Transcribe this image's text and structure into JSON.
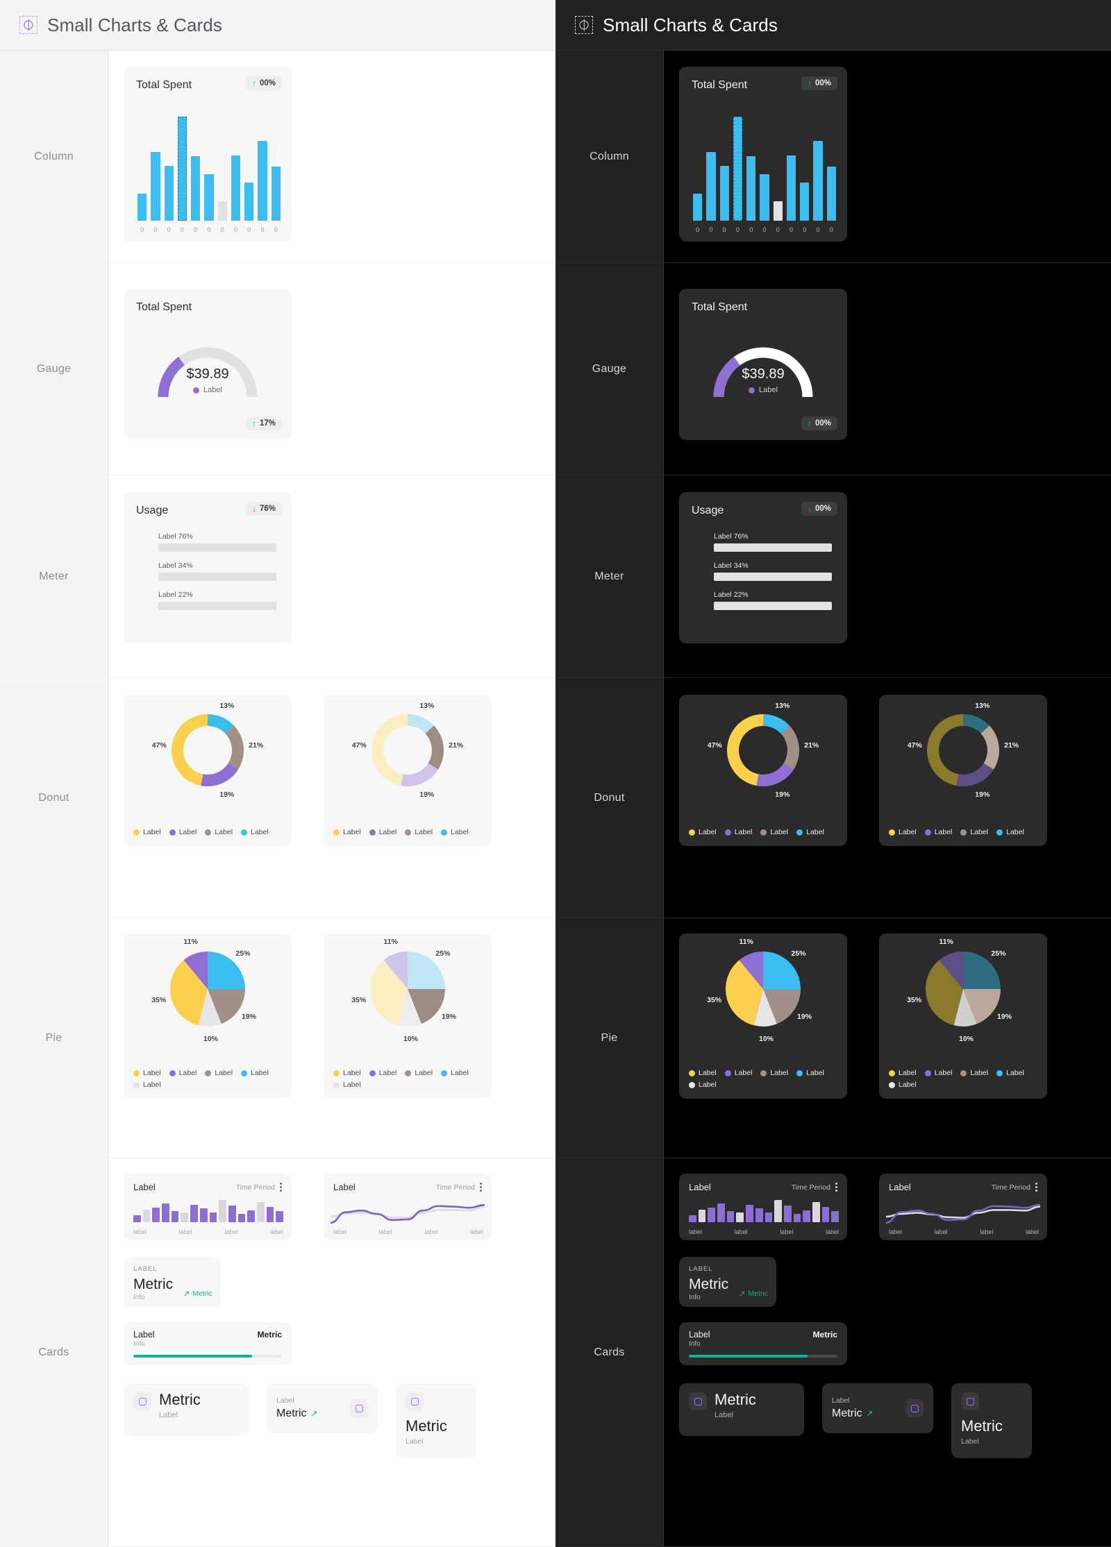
{
  "header": {
    "title": "Small Charts & Cards",
    "icon": "target-crosshair-icon"
  },
  "rows": [
    {
      "label": "Column"
    },
    {
      "label": "Gauge"
    },
    {
      "label": "Meter"
    },
    {
      "label": "Donut"
    },
    {
      "label": "Pie"
    },
    {
      "label": "Cards"
    }
  ],
  "column_card": {
    "title": "Total Spent",
    "badge": {
      "arrow": "↑",
      "text": "00%",
      "direction": "up"
    }
  },
  "gauge_card": {
    "title": "Total Spent",
    "value": "$39.89",
    "legend_label": "Label",
    "badge_light": {
      "arrow": "↑",
      "text": "17%",
      "direction": "up"
    },
    "badge_dark": {
      "arrow": "↑",
      "text": "00%",
      "direction": "up"
    }
  },
  "meter_card": {
    "title": "Usage",
    "badge_light": {
      "arrow": "↓",
      "text": "76%",
      "direction": "down"
    },
    "badge_dark": {
      "arrow": "↓",
      "text": "00%",
      "direction": "down"
    },
    "bars": [
      {
        "label": "Label 76%",
        "value": 76,
        "color": "#ef4a4a"
      },
      {
        "label": "Label 34%",
        "value": 34,
        "color": "#f7cf3f"
      },
      {
        "label": "Label 22%",
        "value": 22,
        "color": "#68c17a"
      }
    ]
  },
  "legend_label": "Label",
  "cards": {
    "bar_spark": {
      "title": "Label",
      "time_period": "Time Period",
      "xlabels": [
        "label",
        "label",
        "label",
        "label"
      ]
    },
    "line_spark": {
      "title": "Label",
      "time_period": "Time Period",
      "xlabels": [
        "label",
        "label",
        "label",
        "label"
      ]
    },
    "metric_a": {
      "label": "LABEL",
      "metric": "Metric",
      "info": "Info",
      "change_arrow": "↗",
      "change": "Metric"
    },
    "metric_b": {
      "label": "Label",
      "info": "Info",
      "metric": "Metric",
      "progress": 80
    },
    "metric_c": {
      "metric": "Metric",
      "label": "Label",
      "icon": "square-icon"
    },
    "metric_d": {
      "label": "Label",
      "metric": "Metric",
      "arrow": "↗",
      "icon": "square-icon"
    },
    "metric_e": {
      "metric": "Metric",
      "label": "Label",
      "icon": "square-icon"
    }
  },
  "chart_data": [
    {
      "type": "bar",
      "title": "Total Spent",
      "name": "column-chart",
      "categories": [
        "0",
        "0",
        "0",
        "0",
        "0",
        "0",
        "0",
        "0",
        "0",
        "0",
        "0"
      ],
      "values": [
        26,
        66,
        53,
        100,
        62,
        45,
        19,
        63,
        37,
        77,
        52
      ],
      "inactive_index": 6,
      "selected_index": 3,
      "color": "#3cbdf0",
      "inactive_color": "#e2e2e4",
      "ylim": [
        0,
        100
      ],
      "grid": false
    },
    {
      "type": "gauge",
      "title": "Total Spent",
      "name": "gauge-chart",
      "value": 39.89,
      "value_label": "$39.89",
      "percent": 30,
      "color": "#8e6fd4",
      "track_color": "#e2e2e4",
      "legend": [
        "Label"
      ]
    },
    {
      "type": "bar",
      "name": "meter-chart",
      "title": "Usage",
      "orientation": "horizontal",
      "categories": [
        "Label 76%",
        "Label 34%",
        "Label 22%"
      ],
      "values": [
        76,
        34,
        22
      ],
      "colors": [
        "#ef4a4a",
        "#f7cf3f",
        "#68c17a"
      ],
      "ylim": [
        0,
        100
      ]
    },
    {
      "type": "pie",
      "name": "donut-chart-primary",
      "variant": "donut",
      "labels": [
        "Label",
        "Label",
        "Label",
        "Label"
      ],
      "values": [
        47,
        19,
        21,
        13
      ],
      "display_order": [
        13,
        21,
        19,
        47
      ],
      "colors": [
        "#fbd04d",
        "#8e6fd4",
        "#a29086",
        "#3cbdf0"
      ],
      "legend_position": "bottom"
    },
    {
      "type": "pie",
      "name": "donut-chart-pastel",
      "variant": "donut",
      "labels": [
        "Label",
        "Label",
        "Label",
        "Label"
      ],
      "values": [
        47,
        19,
        21,
        13
      ],
      "colors": [
        "#fbeec0",
        "#cfc4ea",
        "#9e8b81",
        "#bfe6f7"
      ],
      "legend_colors": [
        "#fbd04d",
        "#8e6fd4",
        "#a29086",
        "#3cbdf0"
      ],
      "legend_position": "bottom"
    },
    {
      "type": "pie",
      "name": "donut-chart-muted-dark",
      "variant": "donut",
      "labels": [
        "Label",
        "Label",
        "Label",
        "Label"
      ],
      "values": [
        47,
        19,
        21,
        13
      ],
      "colors": [
        "#8a7a2c",
        "#5d4e86",
        "#bba79c",
        "#2e6d80"
      ],
      "legend_colors": [
        "#fbd04d",
        "#8e6fd4",
        "#a29086",
        "#3cbdf0"
      ],
      "legend_position": "bottom"
    },
    {
      "type": "pie",
      "name": "pie-chart-primary",
      "variant": "pie",
      "labels": [
        "Label",
        "Label",
        "Label",
        "Label",
        "Label"
      ],
      "values": [
        35,
        11,
        25,
        19,
        10
      ],
      "display_order": [
        25,
        19,
        10,
        35,
        11
      ],
      "colors": [
        "#fbd04d",
        "#8e6fd4",
        "#a29086",
        "#3cbdf0",
        "#e6e6e8"
      ],
      "legend_position": "bottom"
    },
    {
      "type": "pie",
      "name": "pie-chart-pastel",
      "variant": "pie",
      "labels": [
        "Label",
        "Label",
        "Label",
        "Label",
        "Label"
      ],
      "values": [
        35,
        11,
        25,
        19,
        10
      ],
      "colors": [
        "#fbeec0",
        "#cfc4ea",
        "#9e8b81",
        "#bfe6f7",
        "#ededef"
      ],
      "legend_colors": [
        "#fbd04d",
        "#8e6fd4",
        "#a29086",
        "#3cbdf0",
        "#e6e6e8"
      ],
      "legend_position": "bottom"
    },
    {
      "type": "pie",
      "name": "pie-chart-muted-dark",
      "variant": "pie",
      "labels": [
        "Label",
        "Label",
        "Label",
        "Label",
        "Label"
      ],
      "values": [
        35,
        11,
        25,
        19,
        10
      ],
      "colors": [
        "#8a7a2c",
        "#5d4e86",
        "#bba79c",
        "#2e6d80",
        "#cfcfd2"
      ],
      "legend_colors": [
        "#fbd04d",
        "#8e6fd4",
        "#a29086",
        "#3cbdf0",
        "#e6e6e8"
      ],
      "legend_position": "bottom"
    },
    {
      "type": "bar",
      "name": "sparkline-bar",
      "title": "Label",
      "subtitle": "Time Period",
      "categories": [
        "label",
        "label",
        "label",
        "label"
      ],
      "values": [
        28,
        52,
        62,
        80,
        46,
        40,
        74,
        58,
        42,
        94,
        70,
        34,
        50,
        84,
        64,
        46
      ],
      "color": "#8b6fd4"
    },
    {
      "type": "line",
      "name": "sparkline-line",
      "title": "Label",
      "subtitle": "Time Period",
      "categories": [
        "label",
        "label",
        "label",
        "label"
      ],
      "series": [
        {
          "name": "primary",
          "values": [
            8,
            46,
            52,
            40,
            18,
            20,
            52,
            68,
            66,
            62,
            72
          ],
          "color": "#7d5fc9"
        },
        {
          "name": "comparison",
          "values": [
            30,
            40,
            44,
            38,
            28,
            26,
            44,
            54,
            54,
            52,
            66
          ],
          "color": "#dcdce0"
        }
      ]
    }
  ],
  "colors": {
    "blue": "#3cbdf0",
    "yellow": "#fbd04d",
    "purple": "#8e6fd4",
    "taupe": "#a29086",
    "gray": "#e6e6e8",
    "teal": "#12b398",
    "green_up": "#22c07e",
    "red_down": "#ef4444"
  }
}
